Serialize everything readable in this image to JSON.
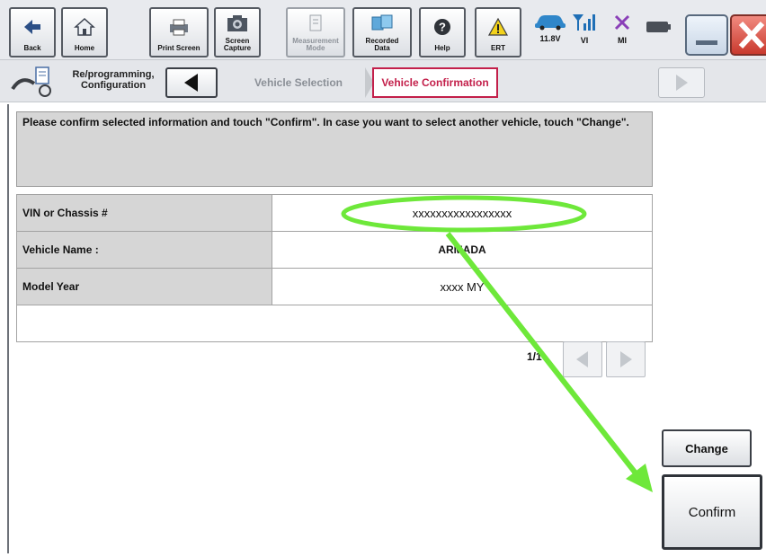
{
  "toolbar": {
    "buttons": [
      {
        "label": "Back",
        "icon": "back-arrow-icon"
      },
      {
        "label": "Home",
        "icon": "home-icon"
      },
      {
        "label": "Print Screen",
        "icon": "printer-icon"
      },
      {
        "label": "Screen\nCapture",
        "icon": "camera-icon"
      },
      {
        "label": "Measurement\nMode",
        "icon": "measurement-icon"
      },
      {
        "label": "Recorded\nData",
        "icon": "recorded-data-icon"
      },
      {
        "label": "Help",
        "icon": "help-icon"
      },
      {
        "label": "ERT",
        "icon": "warning-icon"
      }
    ],
    "status": {
      "battery_voltage": "11.8V",
      "vi_label": "VI",
      "mi_label": "MI"
    }
  },
  "navbar": {
    "section_label": "Re/programming,\nConfiguration",
    "steps": [
      "Vehicle Selection",
      "Vehicle Confirmation"
    ],
    "active_step": "Vehicle Confirmation"
  },
  "main": {
    "message": "Please confirm selected information and touch \"Confirm\". In case you want to select another vehicle, touch \"Change\".",
    "rows": [
      {
        "key": "VIN or Chassis #",
        "value": "xxxxxxxxxxxxxxxxx"
      },
      {
        "key": "Vehicle Name :",
        "value": "ARMADA"
      },
      {
        "key": "Model Year",
        "value": "xxxx MY"
      }
    ],
    "pager": "1/1"
  },
  "actions": {
    "change_label": "Change",
    "confirm_label": "Confirm"
  },
  "colors": {
    "accent": "#c31f4a",
    "highlight": "#6ee83a"
  }
}
